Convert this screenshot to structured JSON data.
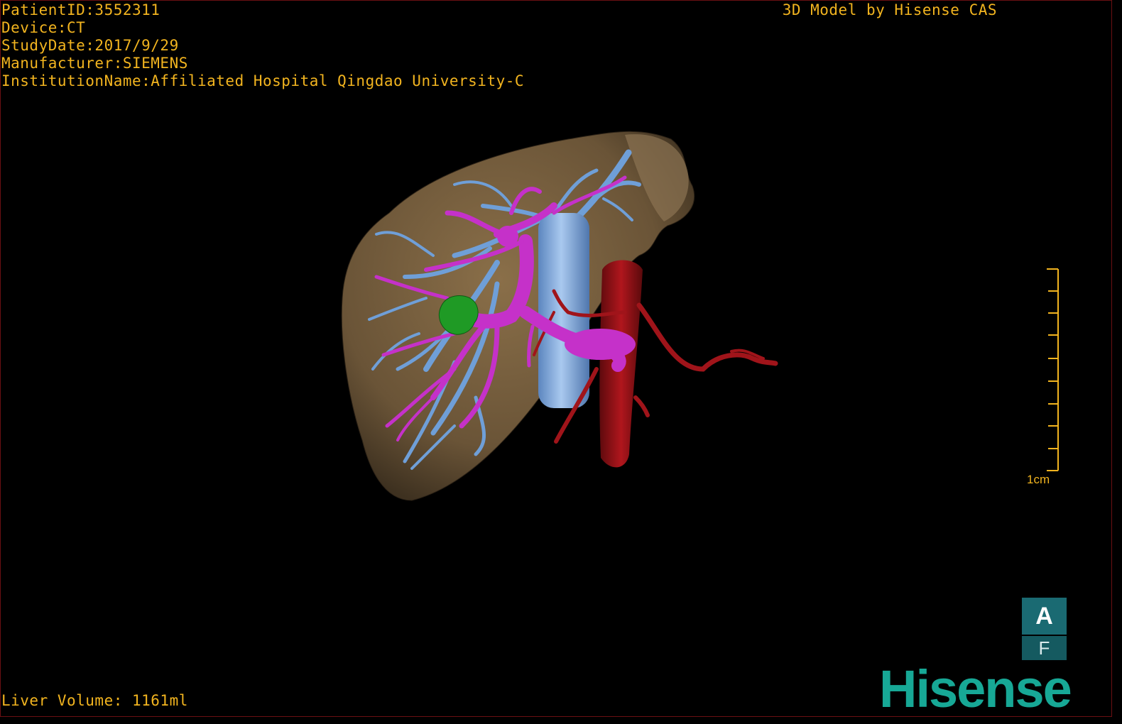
{
  "header": {
    "patient_id": "PatientID:3552311",
    "device": "Device:CT",
    "study_date": "StudyDate:2017/9/29",
    "manufacturer": "Manufacturer:SIEMENS",
    "institution": "InstitutionName:Affiliated Hospital Qingdao University-C"
  },
  "credit": "3D Model by Hisense CAS",
  "footer": {
    "liver_volume": "Liver Volume: 1161ml"
  },
  "scale_bar": {
    "label": "1cm"
  },
  "orientation": {
    "top": "A",
    "bottom": "F"
  },
  "logo": "Hisense",
  "colors": {
    "text": "#f2b41f",
    "liver": "#7a6240",
    "portal_vein": "#c531c9",
    "hepatic_vein": "#6f9fd8",
    "artery": "#a0141a",
    "lesion": "#1f9a25",
    "brand": "#17a896"
  }
}
